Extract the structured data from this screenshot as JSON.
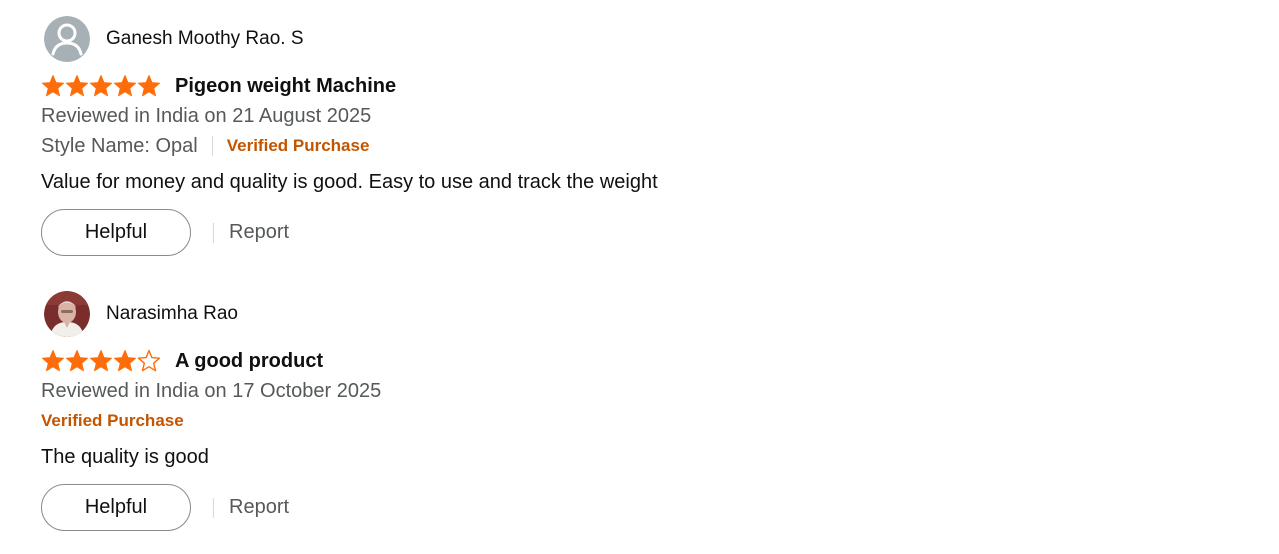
{
  "colors": {
    "star": "#ff6d0a",
    "verified": "#c45500",
    "muted_text": "#565959",
    "primary_text": "#0f1111"
  },
  "reviews": [
    {
      "profile_name": "Ganesh Moothy Rao. S",
      "avatar": "default-user-icon",
      "rating": 5,
      "title": "Pigeon weight Machine",
      "date": "Reviewed in India on 21 August 2025",
      "style": "Style Name: Opal",
      "verified": "Verified Purchase",
      "body": "Value for money and quality is good. Easy to use and track the weight",
      "helpful_label": "Helpful",
      "report_label": "Report"
    },
    {
      "profile_name": "Narasimha Rao",
      "avatar": "user-photo",
      "rating": 4,
      "title": "A good product",
      "date": "Reviewed in India on 17 October 2025",
      "verified": "Verified Purchase",
      "body": "The quality is good",
      "helpful_label": "Helpful",
      "report_label": "Report"
    }
  ]
}
